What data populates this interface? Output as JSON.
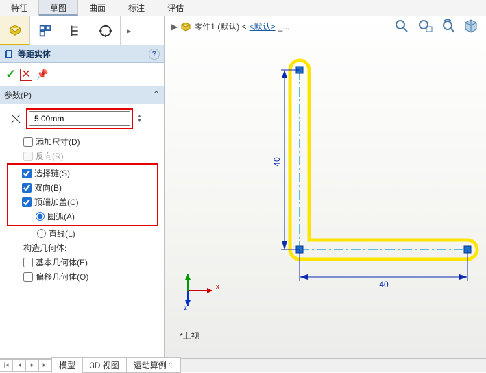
{
  "tabs": {
    "feature": "特征",
    "sketch": "草图",
    "surface": "曲面",
    "annotate": "标注",
    "evaluate": "评估"
  },
  "crumb": {
    "part_prefix": "零件1 (默认) <",
    "part_link": "<默认>",
    "part_suffix": "_..."
  },
  "pm": {
    "title": "等距实体",
    "help": "?",
    "ok": "✓",
    "cancel": "✕",
    "pin": "⟟"
  },
  "params": {
    "header": "参数(P)",
    "offset_value": "5.00mm",
    "add_dim": "添加尺寸(D)",
    "reverse": "反向(R)",
    "select_chain": "选择链(S)",
    "bidir": "双向(B)",
    "cap_ends": "顶端加盖(C)",
    "arc": "圆弧(A)",
    "line": "直线(L)",
    "construct_header": "构造几何体:",
    "base_geom": "基本几何体(E)",
    "offset_geom": "偏移几何体(O)"
  },
  "dims": {
    "vert": "40",
    "horiz": "40"
  },
  "triad": {
    "x": "X",
    "z": "z"
  },
  "view_label": "*上视",
  "bottom": {
    "model": "模型",
    "view3d": "3D 视图",
    "motion": "运动算例 1"
  }
}
